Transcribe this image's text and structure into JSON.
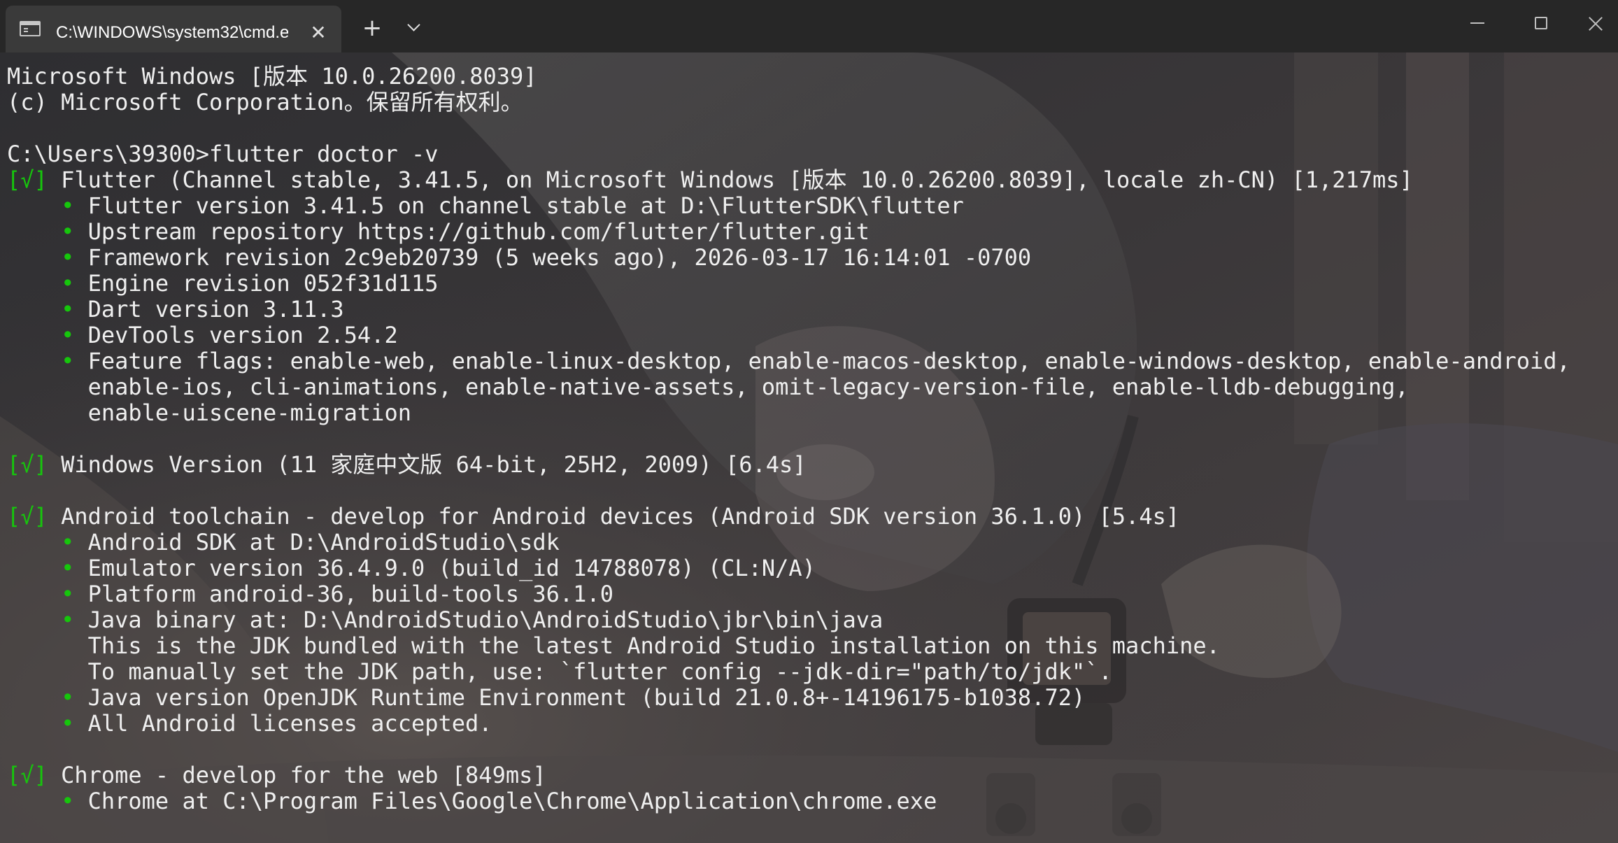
{
  "window": {
    "tab_title": "C:\\WINDOWS\\system32\\cmd.e",
    "tab_close_glyph": "✕",
    "new_tab_glyph": "+"
  },
  "colors": {
    "check_green": "#16c60c",
    "text": "#efefef",
    "titlebar": "#272727",
    "tab_active": "#3a3a3a"
  },
  "terminal": {
    "lines": [
      {
        "text": "Microsoft Windows [版本 10.0.26200.8039]"
      },
      {
        "text": "(c) Microsoft Corporation。保留所有权利。"
      },
      {
        "text": ""
      },
      {
        "text": "C:\\Users\\39300>flutter doctor -v"
      },
      {
        "check": "[√]",
        "text": " Flutter (Channel stable, 3.41.5, on Microsoft Windows [版本 10.0.26200.8039], locale zh-CN) [1,217ms]"
      },
      {
        "indent": "    ",
        "bullet": "•",
        "text": " Flutter version 3.41.5 on channel stable at D:\\FlutterSDK\\flutter"
      },
      {
        "indent": "    ",
        "bullet": "•",
        "text": " Upstream repository https://github.com/flutter/flutter.git"
      },
      {
        "indent": "    ",
        "bullet": "•",
        "text": " Framework revision 2c9eb20739 (5 weeks ago), 2026-03-17 16:14:01 -0700"
      },
      {
        "indent": "    ",
        "bullet": "•",
        "text": " Engine revision 052f31d115"
      },
      {
        "indent": "    ",
        "bullet": "•",
        "text": " Dart version 3.11.3"
      },
      {
        "indent": "    ",
        "bullet": "•",
        "text": " DevTools version 2.54.2"
      },
      {
        "indent": "    ",
        "bullet": "•",
        "text": " Feature flags: enable-web, enable-linux-desktop, enable-macos-desktop, enable-windows-desktop, enable-android,"
      },
      {
        "text": "      enable-ios, cli-animations, enable-native-assets, omit-legacy-version-file, enable-lldb-debugging,"
      },
      {
        "text": "      enable-uiscene-migration"
      },
      {
        "text": ""
      },
      {
        "check": "[√]",
        "text": " Windows Version (11 家庭中文版 64-bit, 25H2, 2009) [6.4s]"
      },
      {
        "text": ""
      },
      {
        "check": "[√]",
        "text": " Android toolchain - develop for Android devices (Android SDK version 36.1.0) [5.4s]"
      },
      {
        "indent": "    ",
        "bullet": "•",
        "text": " Android SDK at D:\\AndroidStudio\\sdk"
      },
      {
        "indent": "    ",
        "bullet": "•",
        "text": " Emulator version 36.4.9.0 (build_id 14788078) (CL:N/A)"
      },
      {
        "indent": "    ",
        "bullet": "•",
        "text": " Platform android-36, build-tools 36.1.0"
      },
      {
        "indent": "    ",
        "bullet": "•",
        "text": " Java binary at: D:\\AndroidStudio\\AndroidStudio\\jbr\\bin\\java"
      },
      {
        "text": "      This is the JDK bundled with the latest Android Studio installation on this machine."
      },
      {
        "text": "      To manually set the JDK path, use: `flutter config --jdk-dir=\"path/to/jdk\"`."
      },
      {
        "indent": "    ",
        "bullet": "•",
        "text": " Java version OpenJDK Runtime Environment (build 21.0.8+-14196175-b1038.72)"
      },
      {
        "indent": "    ",
        "bullet": "•",
        "text": " All Android licenses accepted."
      },
      {
        "text": ""
      },
      {
        "check": "[√]",
        "text": " Chrome - develop for the web [849ms]"
      },
      {
        "indent": "    ",
        "bullet": "•",
        "text": " Chrome at C:\\Program Files\\Google\\Chrome\\Application\\chrome.exe"
      }
    ]
  }
}
